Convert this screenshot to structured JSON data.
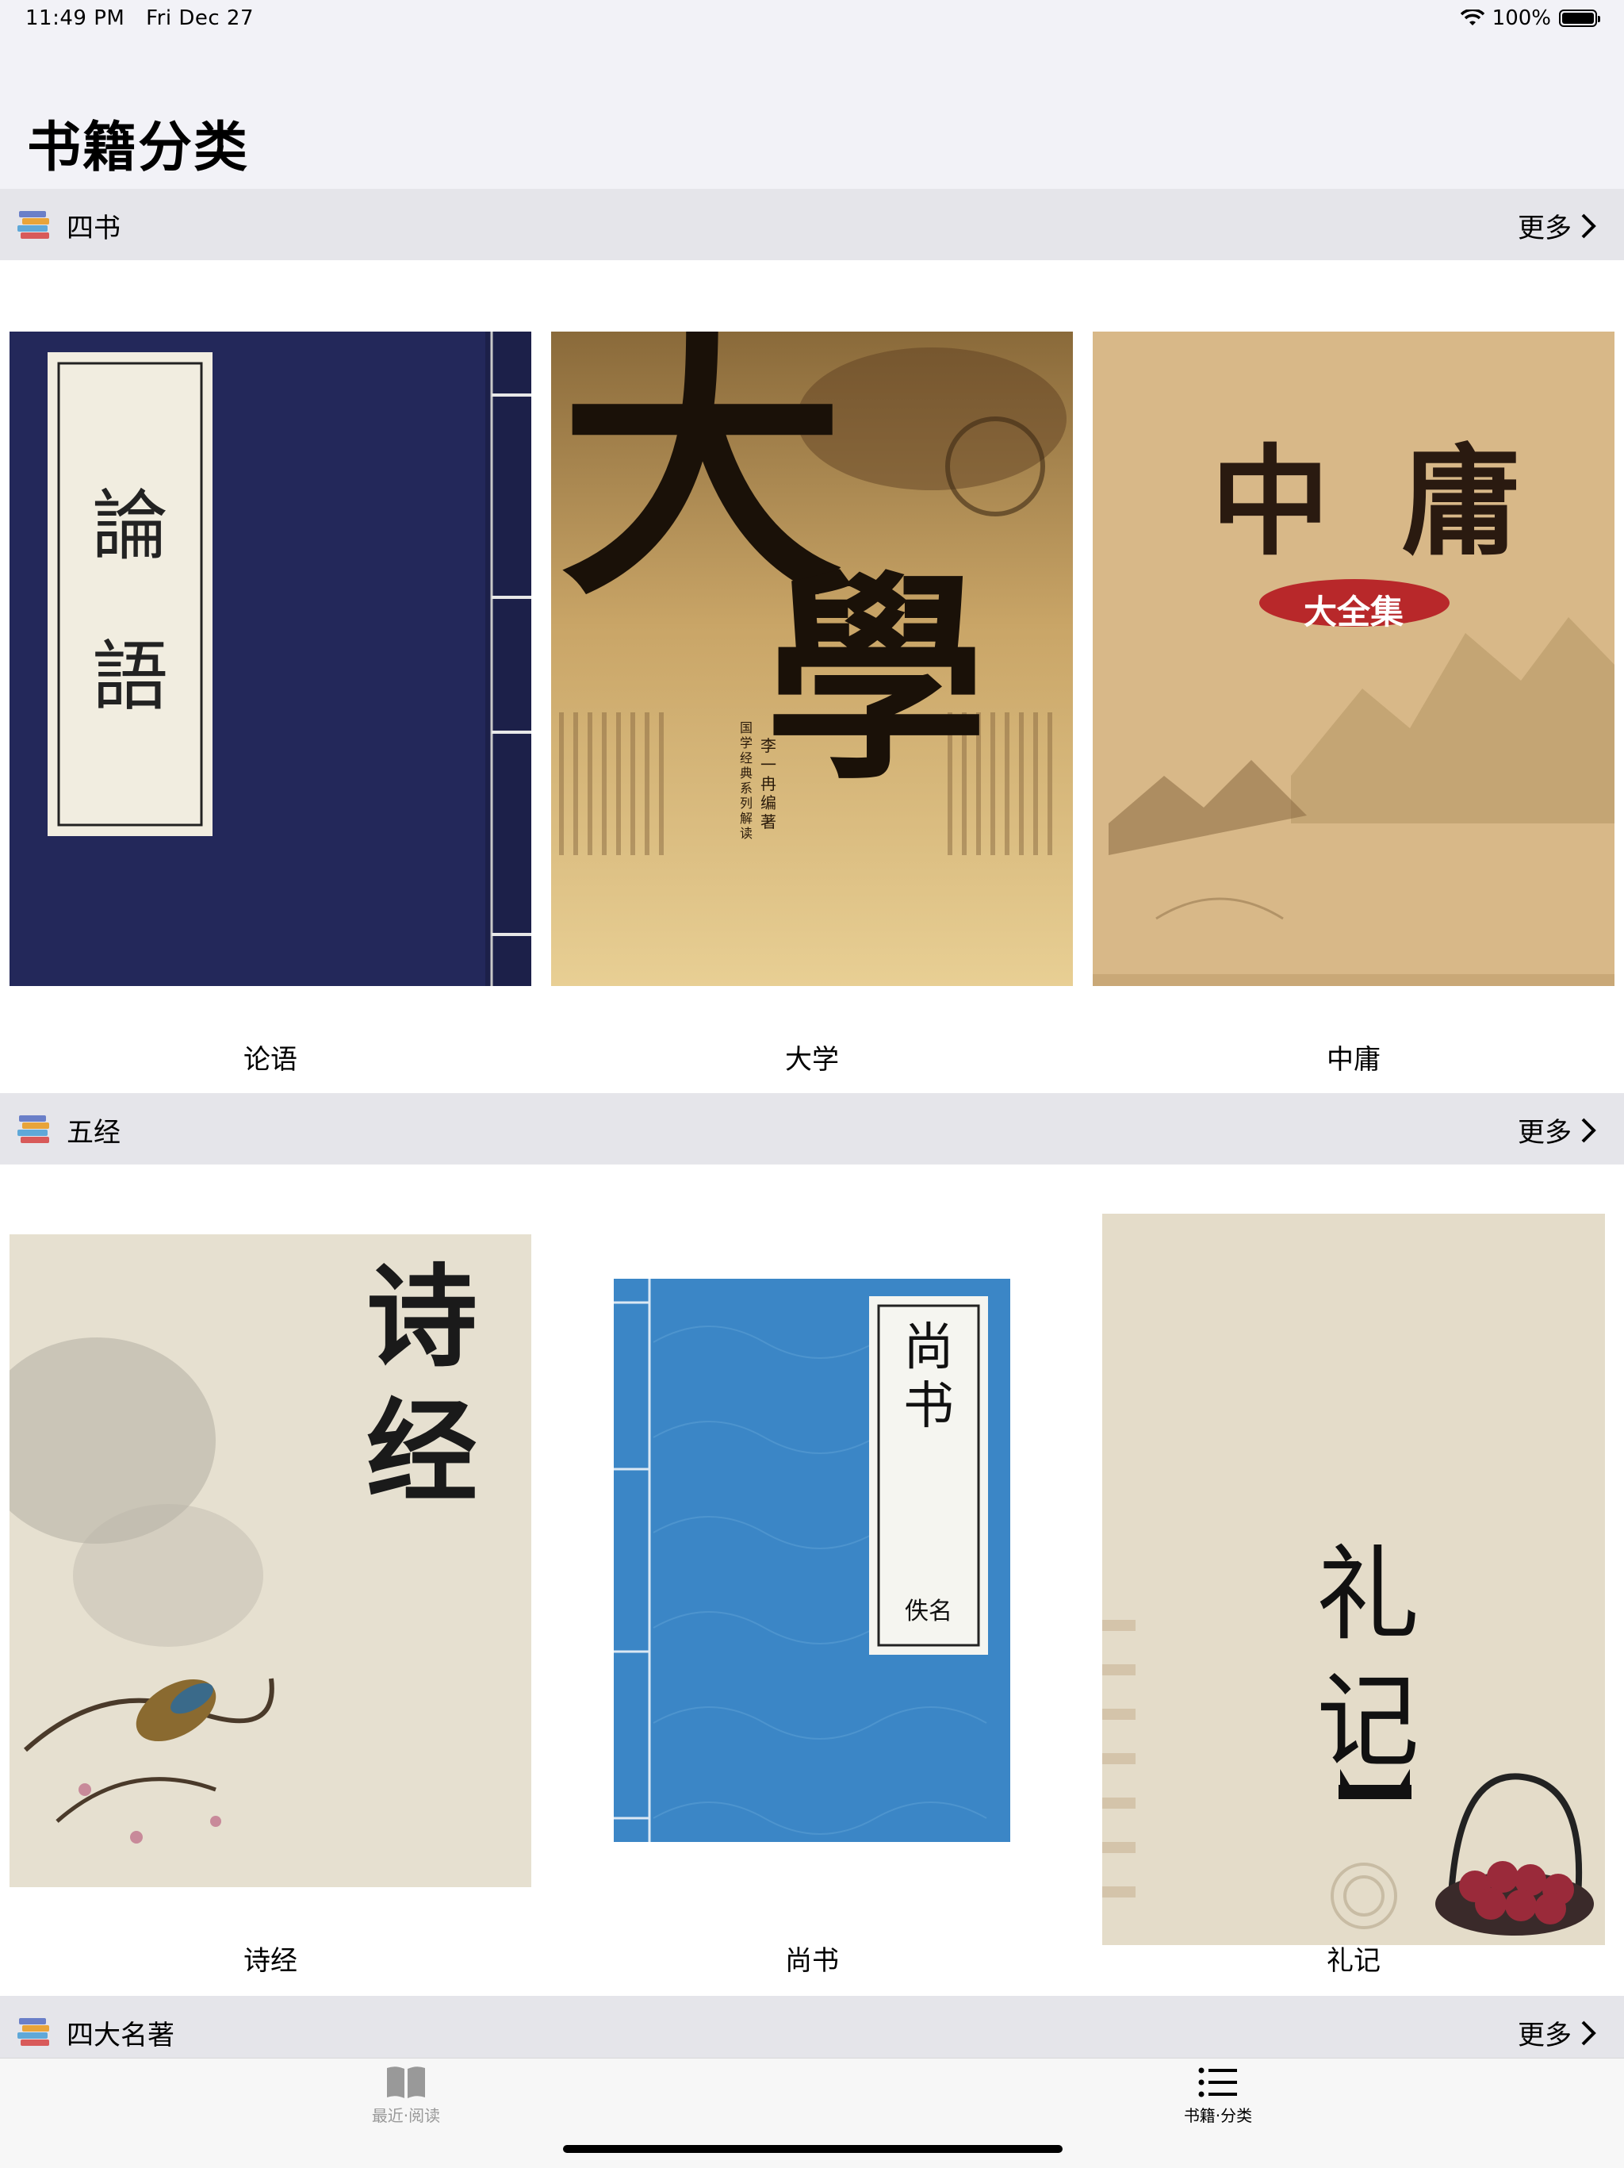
{
  "status_bar": {
    "time": "11:49 PM",
    "date": "Fri Dec 27",
    "battery": "100%"
  },
  "page": {
    "title": "书籍分类"
  },
  "sections": [
    {
      "title": "四书",
      "more": "更多",
      "books": [
        "论语",
        "大学",
        "中庸"
      ]
    },
    {
      "title": "五经",
      "more": "更多",
      "books": [
        "诗经",
        "尚书",
        "礼记"
      ]
    },
    {
      "title": "四大名著",
      "more": "更多"
    }
  ],
  "covers": {
    "lunyu": [
      "論",
      "語"
    ],
    "daxue": [
      "大",
      "學",
      "国学经典系列解读",
      "李一冉 编著"
    ],
    "zhongyong": [
      "中",
      "庸",
      "大全集"
    ],
    "shijing": [
      "诗",
      "经"
    ],
    "shangshu": [
      "尚",
      "书",
      "佚名"
    ],
    "liji": [
      "礼",
      "记"
    ]
  },
  "tabs": [
    {
      "label": "最近·阅读",
      "icon": "book-icon",
      "active": false
    },
    {
      "label": "书籍·分类",
      "icon": "list-icon",
      "active": true
    }
  ],
  "colors": {
    "accent": "#000000",
    "inactive": "#999999",
    "header_bg": "#e5e5ea"
  }
}
